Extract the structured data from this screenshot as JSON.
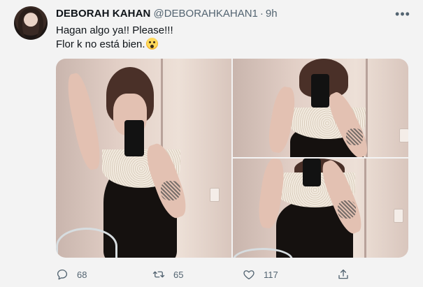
{
  "tweet": {
    "author_name": "DEBORAH KAHAN",
    "author_handle": "@DEBORAHKAHAN1",
    "separator": "·",
    "time": "9h",
    "more_icon": "more-horizontal-icon",
    "text_line1": "Hagan algo ya!! Please!!!",
    "text_line2": "Flor k no está bien.",
    "emoji": "face-screaming-in-fear"
  },
  "media": {
    "count": 3,
    "layout": "one-left-two-right"
  },
  "actions": {
    "reply": {
      "icon": "reply-icon",
      "count": "68"
    },
    "retweet": {
      "icon": "retweet-icon",
      "count": "65"
    },
    "like": {
      "icon": "heart-icon",
      "count": "117"
    },
    "share": {
      "icon": "share-icon"
    }
  },
  "colors": {
    "background": "#f3f3f3",
    "text_primary": "#0f1419",
    "text_secondary": "#536471"
  }
}
